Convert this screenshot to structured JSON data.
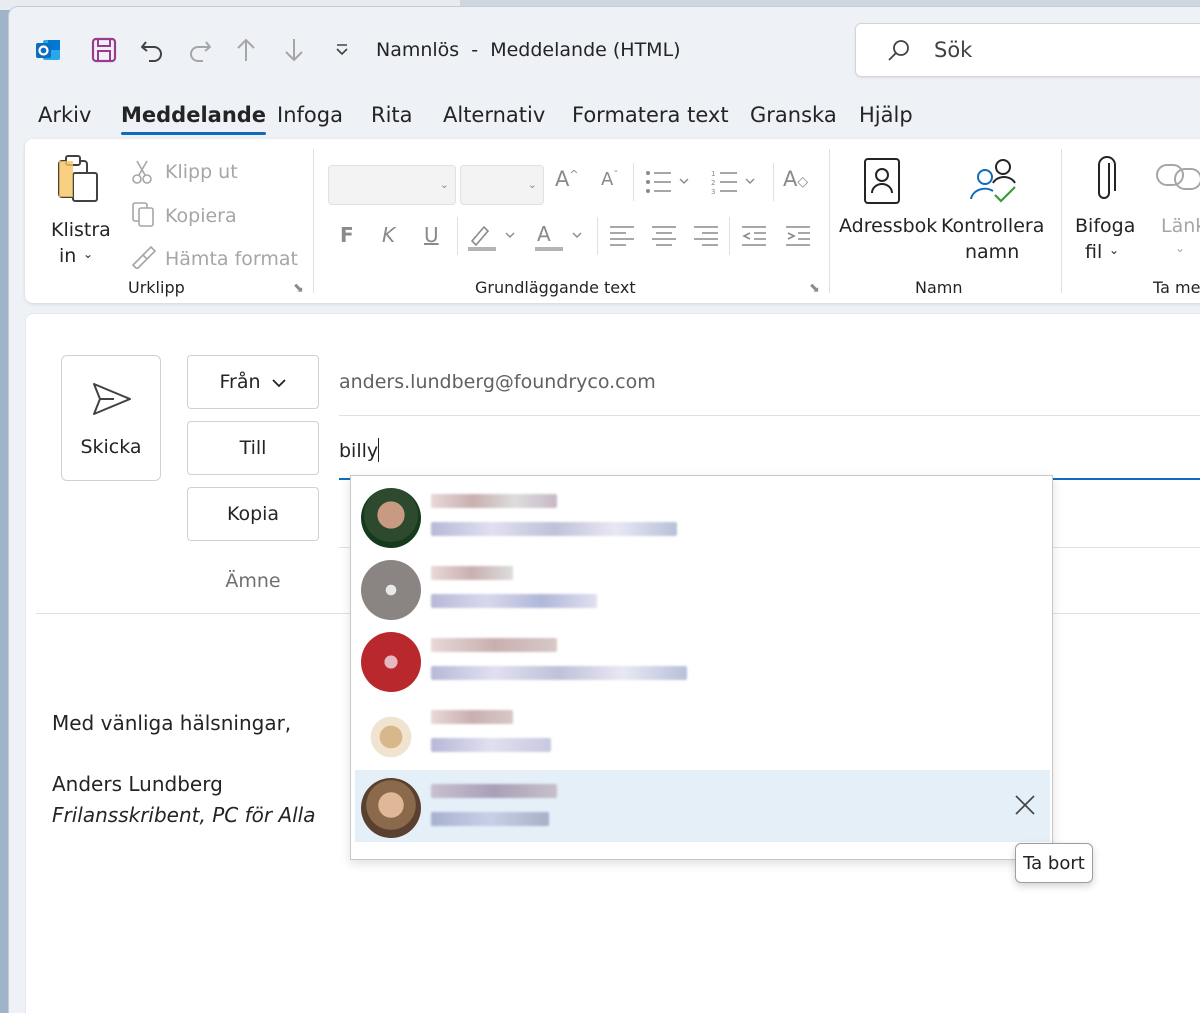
{
  "window": {
    "title": "Namnlös  -  Meddelande (HTML)"
  },
  "search": {
    "label": "Sök"
  },
  "tabs": [
    {
      "label": "Arkiv",
      "active": false
    },
    {
      "label": "Meddelande",
      "active": true
    },
    {
      "label": "Infoga",
      "active": false
    },
    {
      "label": "Rita",
      "active": false
    },
    {
      "label": "Alternativ",
      "active": false
    },
    {
      "label": "Formatera text",
      "active": false
    },
    {
      "label": "Granska",
      "active": false
    },
    {
      "label": "Hjälp",
      "active": false
    }
  ],
  "ribbon": {
    "clipboard": {
      "paste_line1": "Klistra",
      "paste_line2": "in",
      "cut": "Klipp ut",
      "copy": "Kopiera",
      "format_painter": "Hämta format",
      "group_label": "Urklipp"
    },
    "basic_text": {
      "bold": "F",
      "italic": "K",
      "underline": "U",
      "group_label": "Grundläggande text"
    },
    "names": {
      "address_book": "Adressbok",
      "check_names_line1": "Kontrollera",
      "check_names_line2": "namn",
      "group_label": "Namn"
    },
    "include": {
      "attach_line1": "Bifoga",
      "attach_line2": "fil",
      "link": "Länk",
      "group_label": "Ta med"
    }
  },
  "compose": {
    "send_label": "Skicka",
    "from_label": "Från",
    "from_value": "anders.lundberg@foundryco.com",
    "to_label": "Till",
    "to_value": "billy",
    "cc_label": "Kopia",
    "subject_label": "Ämne"
  },
  "signature": {
    "greeting": "Med vänliga hälsningar,",
    "name": "Anders Lundberg",
    "title": "Frilansskribent, PC för Alla"
  },
  "suggestions": {
    "remove_tooltip": "Ta bort"
  },
  "colors": {
    "accent": "#0f6cbd",
    "outlook_blue": "#0f6cbd",
    "save_purple": "#9b3b8c",
    "highlight": "#e4eff8"
  }
}
